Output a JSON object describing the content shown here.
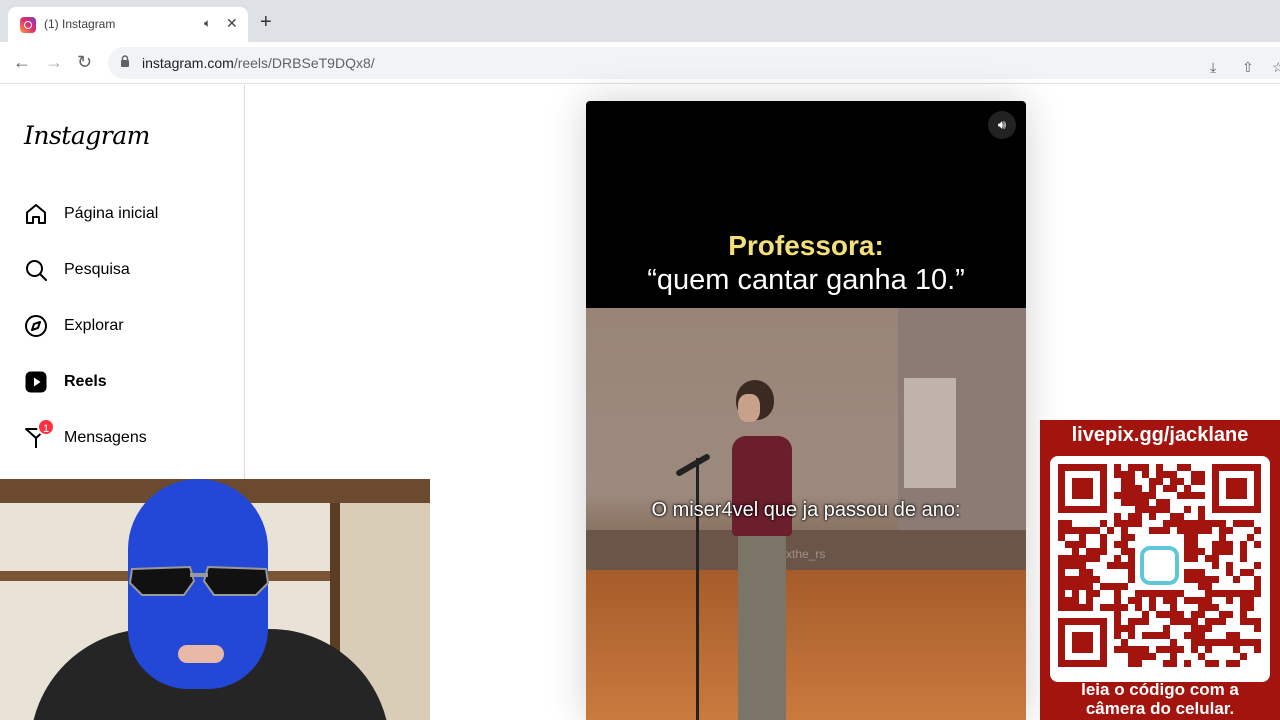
{
  "browser": {
    "tab_title": "(1) Instagram",
    "tab_audio_icon": "speaker-icon",
    "tab_close_icon": "close-icon",
    "newtab_label": "+",
    "url_host": "instagram.com",
    "url_path": "/reels/DRBSeT9DQx8/"
  },
  "sidebar": {
    "logo": "Instagram",
    "items": [
      {
        "label": "Página inicial",
        "icon": "home-icon"
      },
      {
        "label": "Pesquisa",
        "icon": "search-icon"
      },
      {
        "label": "Explorar",
        "icon": "compass-icon"
      },
      {
        "label": "Reels",
        "icon": "reels-icon"
      },
      {
        "label": "Mensagens",
        "icon": "messenger-icon",
        "badge": "1"
      }
    ]
  },
  "reel": {
    "title_line1": "Professora:",
    "title_line2": "“quem cantar ganha 10.”",
    "caption": "O miser4vel que ja passou de ano:",
    "watermark": "xthe_rs",
    "mute_icon": "volume-icon"
  },
  "livepix": {
    "url": "livepix.gg/jacklane",
    "line1": "leia o código com a",
    "line2": "câmera do celular."
  },
  "colors": {
    "title_yellow": "#f3e07a",
    "badge_red": "#ff3040",
    "livepix_bg": "#a3140f"
  }
}
